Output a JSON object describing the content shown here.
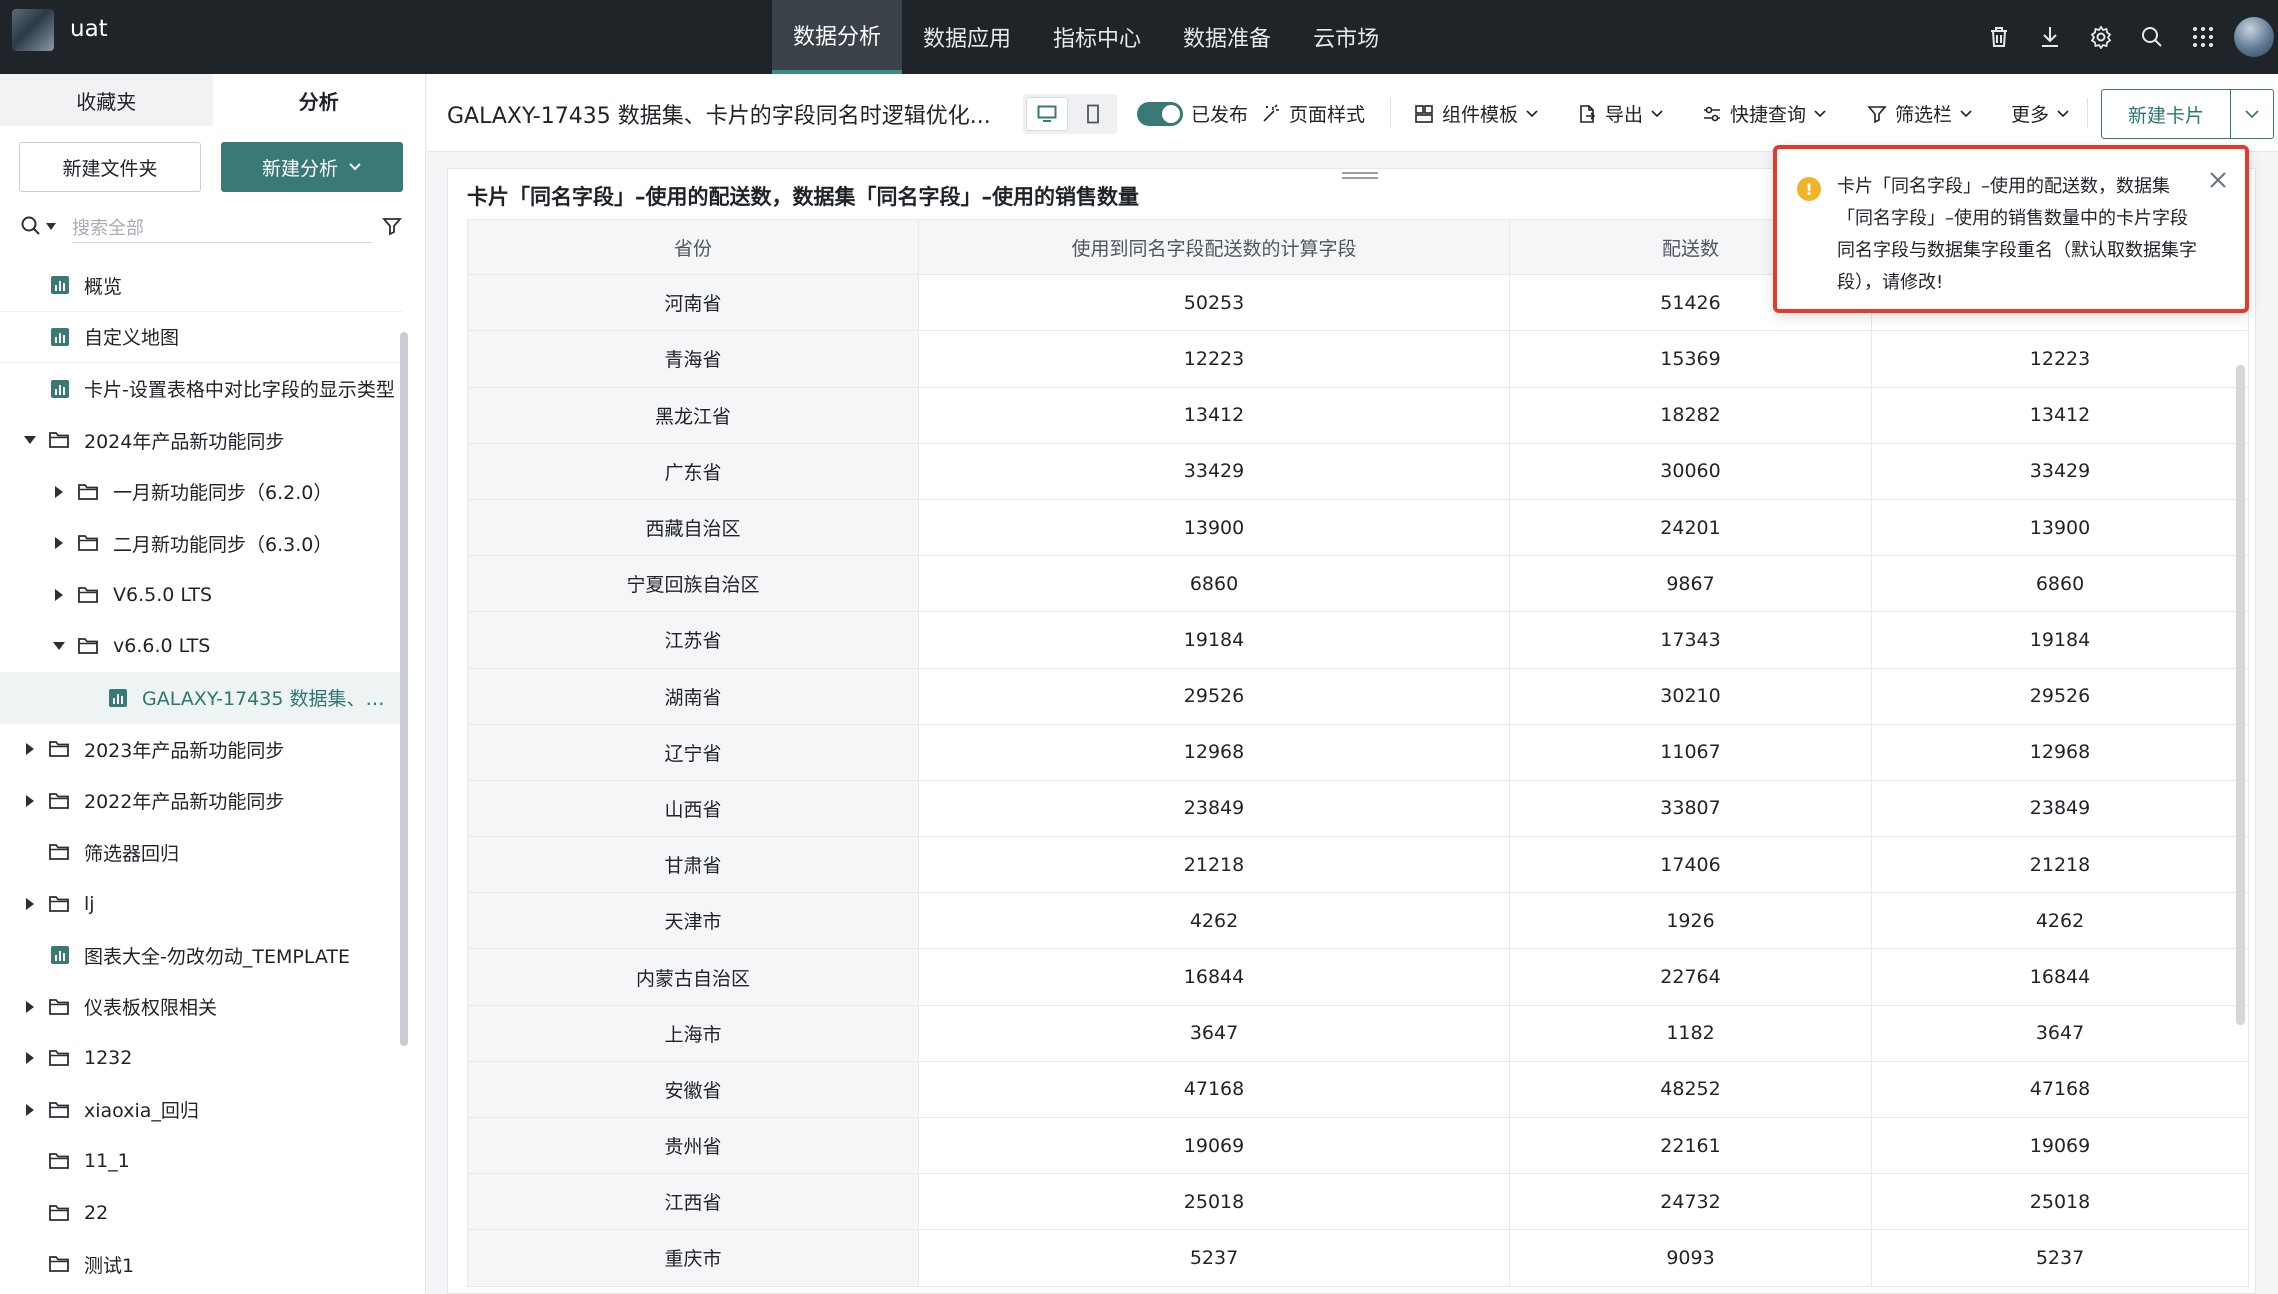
{
  "app": {
    "name": "uat"
  },
  "nav": [
    "数据分析",
    "数据应用",
    "指标中心",
    "数据准备",
    "云市场"
  ],
  "sidebar": {
    "tabs": [
      "收藏夹",
      "分析"
    ],
    "new_folder": "新建文件夹",
    "new_analysis": "新建分析",
    "search_placeholder": "搜索全部",
    "tree": [
      {
        "label": "概览",
        "type": "dashboard",
        "level": 0
      },
      {
        "label": "自定义地图",
        "type": "dashboard",
        "level": 0
      },
      {
        "label": "卡片-设置表格中对比字段的显示类型",
        "type": "dashboard",
        "level": 0
      },
      {
        "label": "2024年产品新功能同步",
        "type": "folder",
        "level": 0,
        "expanded": true
      },
      {
        "label": "一月新功能同步（6.2.0）",
        "type": "folder",
        "level": 1
      },
      {
        "label": "二月新功能同步（6.3.0）",
        "type": "folder",
        "level": 1
      },
      {
        "label": "V6.5.0 LTS",
        "type": "folder",
        "level": 1
      },
      {
        "label": "v6.6.0 LTS",
        "type": "folder",
        "level": 1,
        "expanded": true
      },
      {
        "label": "GALAXY-17435 数据集、卡片的字段同名时逻辑优化",
        "type": "dashboard",
        "level": 2,
        "selected": true
      },
      {
        "label": "2023年产品新功能同步",
        "type": "folder",
        "level": 0
      },
      {
        "label": "2022年产品新功能同步",
        "type": "folder",
        "level": 0
      },
      {
        "label": "筛选器回归",
        "type": "folder",
        "level": 0,
        "leaf": true
      },
      {
        "label": "lj",
        "type": "folder",
        "level": 0
      },
      {
        "label": "图表大全-勿改勿动_TEMPLATE",
        "type": "dashboard",
        "level": 0
      },
      {
        "label": "仪表板权限相关",
        "type": "folder",
        "level": 0
      },
      {
        "label": "1232",
        "type": "folder",
        "level": 0
      },
      {
        "label": "xiaoxia_回归",
        "type": "folder",
        "level": 0
      },
      {
        "label": "11_1",
        "type": "folder",
        "level": 0,
        "leaf": true
      },
      {
        "label": "22",
        "type": "folder",
        "level": 0,
        "leaf": true
      },
      {
        "label": "测试1",
        "type": "folder",
        "level": 0,
        "leaf": true
      }
    ]
  },
  "toolbar": {
    "title": "GALAXY-17435 数据集、卡片的字段同名时逻辑优化...",
    "published": "已发布",
    "page_style": "页面样式",
    "component_template": "组件模板",
    "export": "导出",
    "quick_query": "快捷查询",
    "filter_bar": "筛选栏",
    "more": "更多",
    "new_card": "新建卡片"
  },
  "card": {
    "title": "卡片「同名字段」–使用的配送数，数据集「同名字段」–使用的销售数量",
    "columns": [
      "省份",
      "使用到同名字段配送数的计算字段",
      "配送数",
      ""
    ],
    "rows": [
      [
        "河南省",
        "50253",
        "51426",
        ""
      ],
      [
        "青海省",
        "12223",
        "15369",
        "12223"
      ],
      [
        "黑龙江省",
        "13412",
        "18282",
        "13412"
      ],
      [
        "广东省",
        "33429",
        "30060",
        "33429"
      ],
      [
        "西藏自治区",
        "13900",
        "24201",
        "13900"
      ],
      [
        "宁夏回族自治区",
        "6860",
        "9867",
        "6860"
      ],
      [
        "江苏省",
        "19184",
        "17343",
        "19184"
      ],
      [
        "湖南省",
        "29526",
        "30210",
        "29526"
      ],
      [
        "辽宁省",
        "12968",
        "11067",
        "12968"
      ],
      [
        "山西省",
        "23849",
        "33807",
        "23849"
      ],
      [
        "甘肃省",
        "21218",
        "17406",
        "21218"
      ],
      [
        "天津市",
        "4262",
        "1926",
        "4262"
      ],
      [
        "内蒙古自治区",
        "16844",
        "22764",
        "16844"
      ],
      [
        "上海市",
        "3647",
        "1182",
        "3647"
      ],
      [
        "安徽省",
        "47168",
        "48252",
        "47168"
      ],
      [
        "贵州省",
        "19069",
        "22161",
        "19069"
      ],
      [
        "江西省",
        "25018",
        "24732",
        "25018"
      ],
      [
        "重庆市",
        "5237",
        "9093",
        "5237"
      ]
    ]
  },
  "toast": {
    "message": "卡片「同名字段」–使用的配送数，数据集「同名字段」–使用的销售数量中的卡片字段同名字段与数据集字段重名（默认取数据集字段），请修改!"
  },
  "colors": {
    "topbar": "#1f2429",
    "accent": "#3a7a76",
    "alert_border": "#e5392c",
    "warning_icon": "#f0b429"
  }
}
